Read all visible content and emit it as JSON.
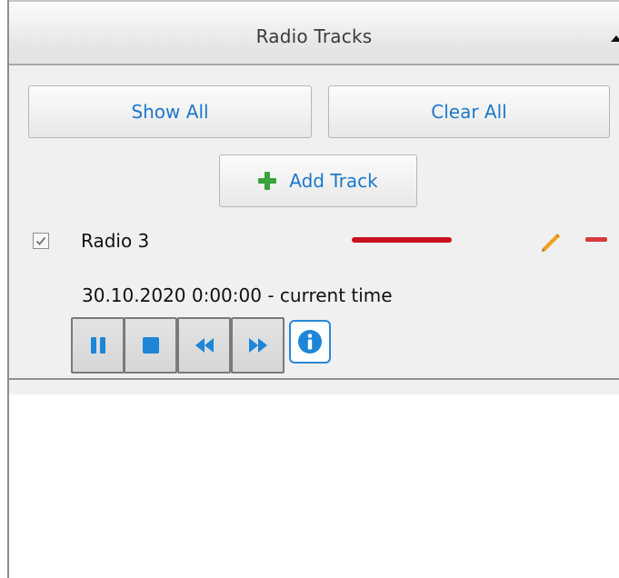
{
  "header": {
    "title": "Radio Tracks",
    "collapse_icon": "triangle-up-icon"
  },
  "toolbar": {
    "show_all_label": "Show All",
    "clear_all_label": "Clear All",
    "add_track_label": "Add Track",
    "add_icon": "plus-icon"
  },
  "track": {
    "checked": true,
    "name": "Radio 3",
    "line_color": "#c8101e",
    "time_range": "30.10.2020 0:00:00 - current time",
    "edit_icon": "pencil-icon",
    "remove_icon": "minus-icon"
  },
  "player": {
    "buttons": [
      "pause-icon",
      "stop-icon",
      "rewind-icon",
      "fast-forward-icon",
      "info-icon"
    ]
  },
  "colors": {
    "accent": "#1d78c9",
    "add": "#3aa33a",
    "edit": "#f0a020",
    "remove": "#d93a3a"
  }
}
